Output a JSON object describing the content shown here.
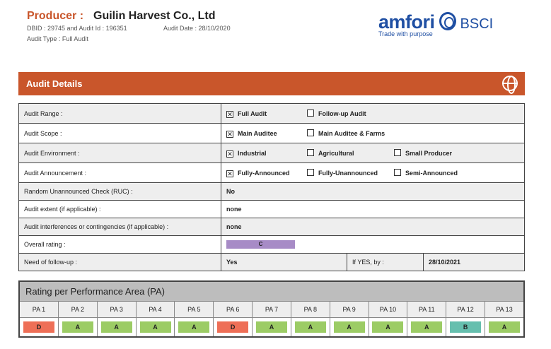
{
  "header": {
    "producer_label": "Producer :",
    "producer_name": "Guilin Harvest Co., Ltd",
    "dbid": "DBID : 29745 and Audit Id : 196351",
    "audit_date": "Audit Date : 28/10/2020",
    "audit_type": "Audit Type : Full Audit"
  },
  "logo": {
    "brand": "amfori",
    "program": "BSCI",
    "tagline": "Trade with purpose"
  },
  "section": {
    "title": "Audit Details"
  },
  "rows": {
    "range": {
      "label": "Audit Range :",
      "opts": [
        {
          "text": "Full Audit",
          "checked": true
        },
        {
          "text": "Follow-up Audit",
          "checked": false
        }
      ]
    },
    "scope": {
      "label": "Audit Scope :",
      "opts": [
        {
          "text": "Main Auditee",
          "checked": true
        },
        {
          "text": "Main Auditee & Farms",
          "checked": false
        }
      ]
    },
    "env": {
      "label": "Audit Environment :",
      "opts": [
        {
          "text": "Industrial",
          "checked": true
        },
        {
          "text": "Agricultural",
          "checked": false
        },
        {
          "text": "Small Producer",
          "checked": false
        }
      ]
    },
    "ann": {
      "label": "Audit Announcement :",
      "opts": [
        {
          "text": "Fully-Announced",
          "checked": true
        },
        {
          "text": "Fully-Unannounced",
          "checked": false
        },
        {
          "text": "Semi-Announced",
          "checked": false
        }
      ]
    },
    "ruc": {
      "label": "Random Unannounced Check (RUC) :",
      "value": "No"
    },
    "extent": {
      "label": "Audit extent (if applicable) :",
      "value": "none"
    },
    "interf": {
      "label": "Audit interferences or contingencies (if applicable) :",
      "value": "none"
    },
    "overall": {
      "label": "Overall rating :",
      "value": "C",
      "color": "#a78bc6"
    },
    "followup": {
      "label": "Need of follow-up :",
      "value": "Yes",
      "by_label": "If YES, by :",
      "by_date": "28/10/2021"
    }
  },
  "pa": {
    "title": "Rating per Performance Area (PA)",
    "items": [
      {
        "name": "PA 1",
        "rating": "D"
      },
      {
        "name": "PA 2",
        "rating": "A"
      },
      {
        "name": "PA 3",
        "rating": "A"
      },
      {
        "name": "PA 4",
        "rating": "A"
      },
      {
        "name": "PA 5",
        "rating": "A"
      },
      {
        "name": "PA 6",
        "rating": "D"
      },
      {
        "name": "PA 7",
        "rating": "A"
      },
      {
        "name": "PA 8",
        "rating": "A"
      },
      {
        "name": "PA 9",
        "rating": "A"
      },
      {
        "name": "PA 10",
        "rating": "A"
      },
      {
        "name": "PA 11",
        "rating": "A"
      },
      {
        "name": "PA 12",
        "rating": "B"
      },
      {
        "name": "PA 13",
        "rating": "A"
      }
    ],
    "colors": {
      "A": "#9ccc65",
      "B": "#66bfae",
      "D": "#ee6f57"
    }
  }
}
